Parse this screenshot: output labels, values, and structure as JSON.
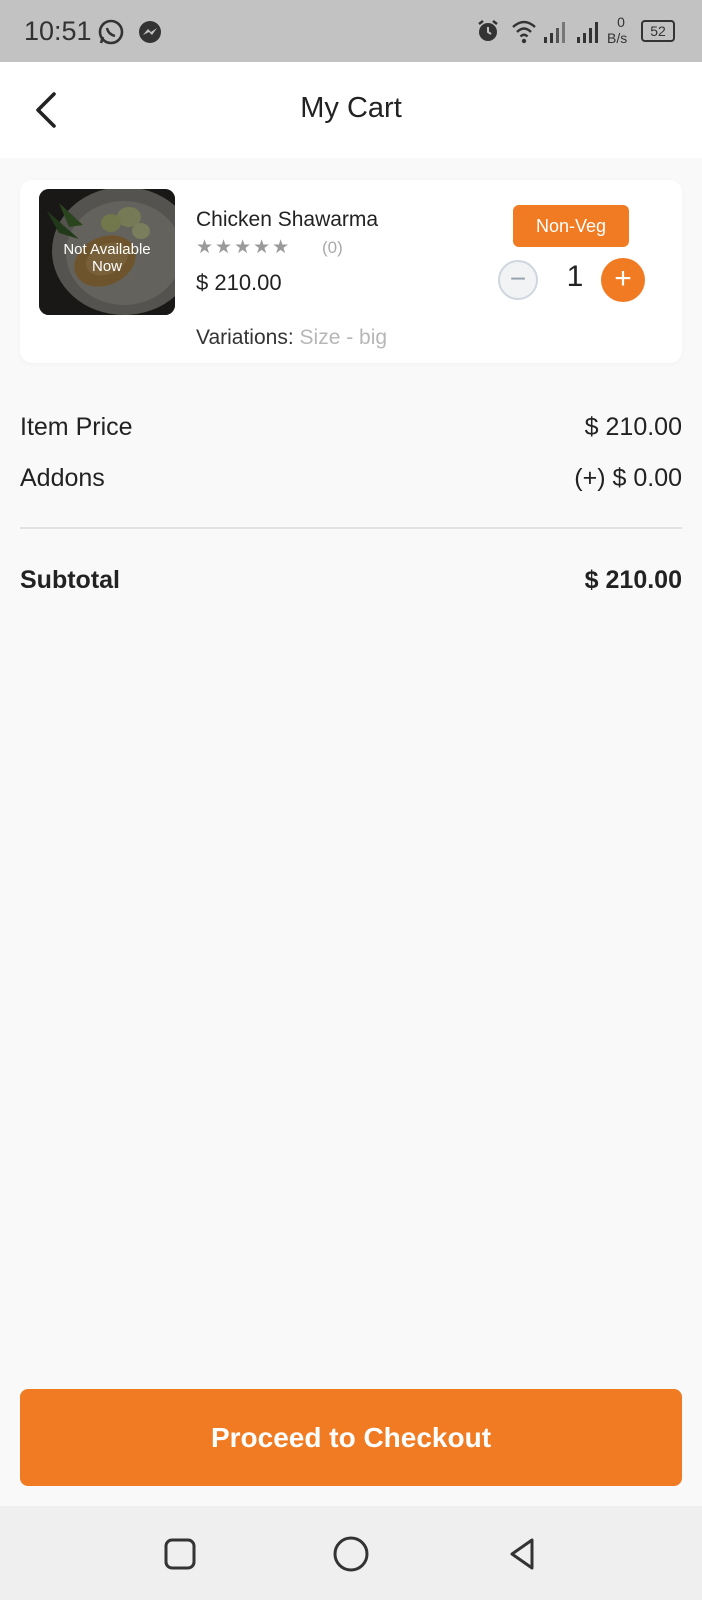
{
  "status_bar": {
    "time": "10:51",
    "net_speed_value": "0",
    "net_speed_unit": "B/s",
    "battery": "52",
    "left_icons": [
      "whatsapp-icon",
      "messenger-icon"
    ],
    "right_icons": [
      "alarm-icon",
      "wifi-icon",
      "signal-icon",
      "signal-icon",
      "battery-icon"
    ]
  },
  "header": {
    "title": "My Cart",
    "back_icon": "back-arrow-icon"
  },
  "cart": {
    "items": [
      {
        "name": "Chicken Shawarma",
        "rating_stars": "★★★★★",
        "rating": 0,
        "rating_count": "(0)",
        "price": "$ 210.00",
        "availability": "Not Available\nNow",
        "badge": "Non-Veg",
        "quantity": "1",
        "minus_symbol": "−",
        "plus_symbol": "+",
        "variations_label": "Variations:",
        "variations_value": "Size - big"
      }
    ]
  },
  "summary": {
    "item_price_label": "Item Price",
    "item_price_value": "$ 210.00",
    "addons_label": "Addons",
    "addons_value": "(+) $ 0.00",
    "subtotal_label": "Subtotal",
    "subtotal_value": "$ 210.00"
  },
  "checkout": {
    "label": "Proceed to Checkout"
  },
  "nav": {
    "icons": [
      "recents-icon",
      "home-icon",
      "back-icon"
    ]
  },
  "colors": {
    "accent": "#f07b23",
    "status_bar": "#c2c2c2",
    "background": "#f9f9f9"
  }
}
